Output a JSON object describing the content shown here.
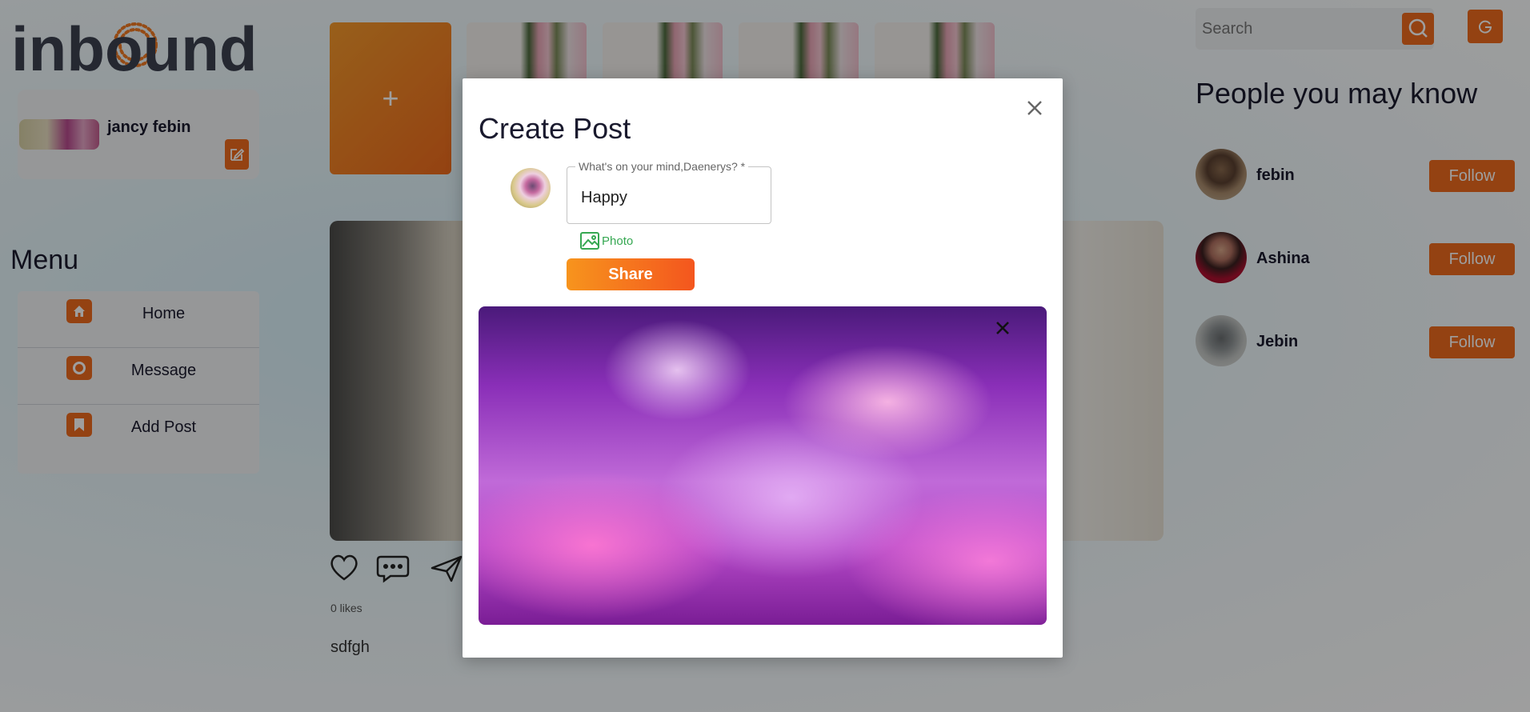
{
  "app": {
    "brand_name": "inbound",
    "brand_color": "#ef6b1d",
    "text_color": "#1a1a2e"
  },
  "profile": {
    "name": "jancy febin",
    "edit_icon": "edit-icon"
  },
  "menu": {
    "title": "Menu",
    "items": [
      {
        "label": "Home",
        "icon": "home-icon"
      },
      {
        "label": "Message",
        "icon": "message-icon"
      },
      {
        "label": "Add Post",
        "icon": "bookmark-icon"
      }
    ]
  },
  "stories": {
    "add_label": "+"
  },
  "post": {
    "likes": "0 likes",
    "caption": "sdfgh",
    "actions": [
      "heart-icon",
      "comment-icon",
      "send-icon"
    ]
  },
  "search": {
    "placeholder": "Search",
    "icon": "search-icon"
  },
  "header": {
    "logout_icon": "google-icon"
  },
  "suggestions": {
    "title": "People you may know",
    "people": [
      {
        "name": "febin",
        "button": "Follow"
      },
      {
        "name": "Ashina",
        "button": "Follow"
      },
      {
        "name": "Jebin",
        "button": "Follow"
      }
    ]
  },
  "modal": {
    "title": "Create Post",
    "field_label": "What's on your mind,Daenerys? *",
    "field_value": "Happy",
    "photo_label": "Photo",
    "share_label": "Share",
    "close_icon": "close-icon",
    "preview_close_icon": "close-icon"
  }
}
